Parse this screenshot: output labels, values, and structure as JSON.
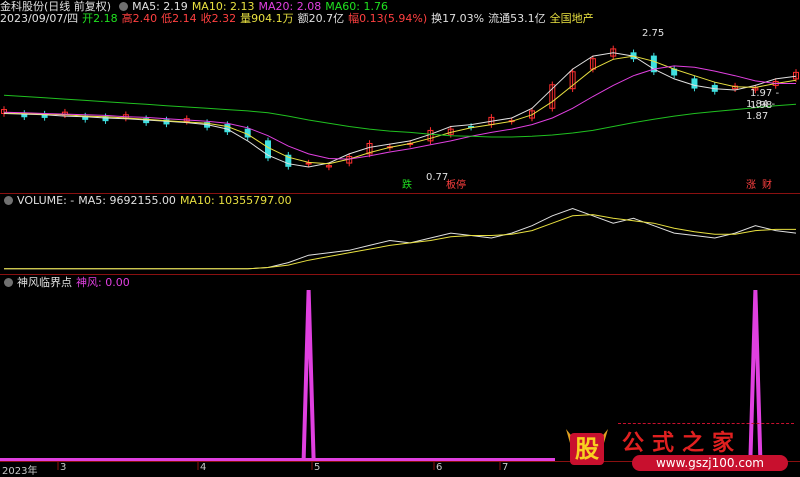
{
  "header": {
    "stock_name": "金科股份(日线 前复权)",
    "ma5": "MA5: 2.19",
    "ma10": "MA10: 2.13",
    "ma20": "MA20: 2.08",
    "ma60": "MA60: 1.76"
  },
  "quote": {
    "date": "2023/09/07/四",
    "open": "开2.18",
    "high": "高2.40",
    "low": "低2.14",
    "close": "收2.32",
    "volume": "量904.1万",
    "amount": "额20.7亿",
    "change": "幅0.13(5.94%)",
    "turnover": "换17.03%",
    "float": "流通53.1亿",
    "sector": "全国地产"
  },
  "price_annotations": {
    "peak": "2.75",
    "trough": "0.77",
    "range_upper": "1.97 - 1.98",
    "range_lower": "1.84 - 1.87"
  },
  "tags": {
    "die": "跌",
    "ban_ting": "板停",
    "zhang": "涨",
    "cai": "财"
  },
  "volume_panel": {
    "title": "VOLUME: -",
    "ma5": "MA5: 9692155.00",
    "ma10": "MA10: 10355797.00"
  },
  "indicator_panel": {
    "title": "神风临界点",
    "value": "神风: 0.00"
  },
  "time_axis": {
    "labels": [
      "2023年",
      "3",
      "4",
      "5",
      "6",
      "7"
    ]
  },
  "watermark": {
    "logo_char": "股",
    "site_name": "公式之家",
    "url": "www.gszj100.com"
  },
  "colors": {
    "up": "#ff3030",
    "down": "#40e0e0",
    "ma5": "#e0e0e0",
    "ma10": "#e8e040",
    "ma20": "#e040e0",
    "ma60": "#20c020",
    "signal": "#e040e0"
  },
  "chart_data": [
    {
      "type": "line",
      "title": "金科股份(日线 前复权)",
      "series": [
        {
          "name": "MA5",
          "values": [
            1.62,
            1.61,
            1.6,
            1.58,
            1.57,
            1.55,
            1.54,
            1.52,
            1.5,
            1.48,
            1.45,
            1.38,
            1.2,
            0.98,
            0.85,
            0.8,
            0.86,
            1.0,
            1.1,
            1.15,
            1.2,
            1.3,
            1.42,
            1.45,
            1.5,
            1.55,
            1.7,
            2.0,
            2.3,
            2.5,
            2.55,
            2.5,
            2.3,
            2.15,
            2.05,
            2.0,
            1.98,
            2.05,
            2.15,
            2.19
          ]
        },
        {
          "name": "MA10",
          "values": [
            1.63,
            1.62,
            1.61,
            1.6,
            1.58,
            1.57,
            1.55,
            1.53,
            1.51,
            1.49,
            1.47,
            1.42,
            1.3,
            1.1,
            0.95,
            0.87,
            0.85,
            0.92,
            1.02,
            1.1,
            1.16,
            1.24,
            1.33,
            1.4,
            1.45,
            1.5,
            1.6,
            1.8,
            2.05,
            2.3,
            2.45,
            2.5,
            2.42,
            2.3,
            2.2,
            2.1,
            2.03,
            2.02,
            2.08,
            2.13
          ]
        },
        {
          "name": "MA20",
          "values": [
            1.64,
            1.63,
            1.62,
            1.61,
            1.6,
            1.59,
            1.57,
            1.56,
            1.54,
            1.52,
            1.5,
            1.47,
            1.4,
            1.28,
            1.12,
            1.0,
            0.93,
            0.92,
            0.97,
            1.03,
            1.08,
            1.14,
            1.2,
            1.27,
            1.33,
            1.38,
            1.45,
            1.55,
            1.7,
            1.88,
            2.05,
            2.2,
            2.3,
            2.35,
            2.33,
            2.27,
            2.2,
            2.12,
            2.08,
            2.08
          ]
        },
        {
          "name": "MA60",
          "values": [
            1.9,
            1.88,
            1.86,
            1.84,
            1.82,
            1.8,
            1.78,
            1.76,
            1.74,
            1.72,
            1.7,
            1.68,
            1.66,
            1.63,
            1.58,
            1.52,
            1.47,
            1.42,
            1.38,
            1.35,
            1.33,
            1.3,
            1.28,
            1.27,
            1.26,
            1.26,
            1.27,
            1.29,
            1.32,
            1.36,
            1.42,
            1.48,
            1.53,
            1.58,
            1.62,
            1.65,
            1.68,
            1.71,
            1.74,
            1.76
          ]
        }
      ],
      "annotations": [
        "2.75",
        "0.77",
        "1.97 - 1.98",
        "1.84 - 1.87"
      ]
    },
    {
      "type": "line",
      "title": "VOLUME",
      "series": [
        {
          "name": "MA5",
          "values": [
            1,
            1,
            1,
            1,
            1,
            1,
            1,
            1,
            1,
            1,
            1,
            1,
            1,
            2,
            6,
            12,
            14,
            16,
            20,
            24,
            22,
            26,
            30,
            28,
            26,
            30,
            36,
            44,
            50,
            44,
            38,
            42,
            36,
            30,
            28,
            26,
            30,
            36,
            32,
            30
          ]
        },
        {
          "name": "MA10",
          "values": [
            1,
            1,
            1,
            1,
            1,
            1,
            1,
            1,
            1,
            1,
            1,
            1,
            1,
            2,
            4,
            8,
            11,
            14,
            17,
            20,
            22,
            24,
            27,
            28,
            28,
            29,
            32,
            38,
            44,
            45,
            42,
            40,
            38,
            34,
            31,
            29,
            29,
            32,
            33,
            33
          ]
        }
      ]
    },
    {
      "type": "bar",
      "title": "神风临界点",
      "series": [
        {
          "name": "神风",
          "values": [
            0,
            0,
            0,
            0,
            0,
            0,
            0,
            0,
            0,
            0,
            0,
            0,
            0,
            0,
            0,
            1,
            0,
            0,
            0,
            0,
            0,
            0,
            0,
            0,
            0,
            0,
            0,
            0,
            0,
            0,
            0,
            0,
            0,
            0,
            0,
            0,
            0,
            1,
            0,
            0
          ]
        }
      ]
    }
  ]
}
